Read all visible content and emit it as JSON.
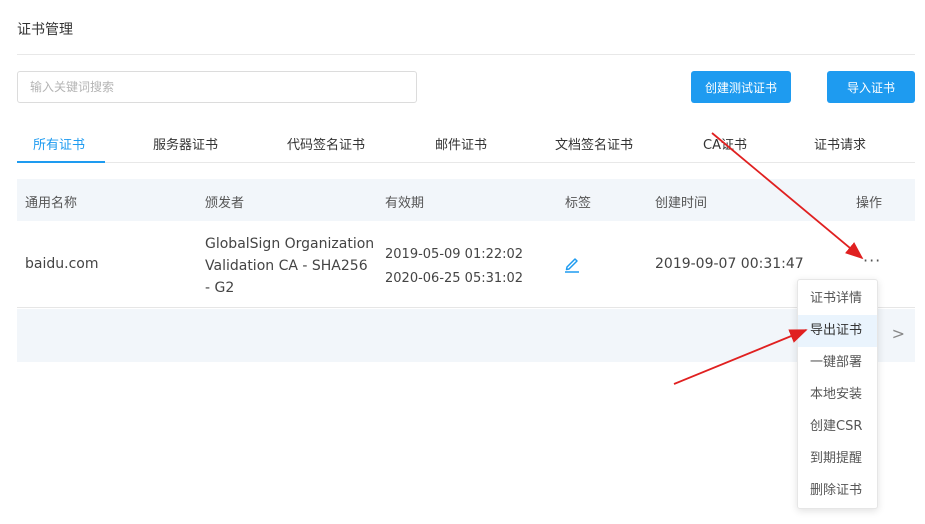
{
  "header": {
    "title": "证书管理"
  },
  "search": {
    "placeholder": "输入关键词搜索",
    "value": ""
  },
  "actions": {
    "create_test_label": "创建测试证书",
    "import_label": "导入证书"
  },
  "tabs": [
    {
      "label": "所有证书",
      "active": true
    },
    {
      "label": "服务器证书"
    },
    {
      "label": "代码签名证书"
    },
    {
      "label": "邮件证书"
    },
    {
      "label": "文档签名证书"
    },
    {
      "label": "CA证书"
    },
    {
      "label": "证书请求"
    }
  ],
  "table": {
    "columns": [
      "通用名称",
      "颁发者",
      "有效期",
      "标签",
      "创建时间",
      "操作"
    ],
    "rows": [
      {
        "common_name": "baidu.com",
        "issuer_lines": [
          "GlobalSign Organization",
          "Validation CA - SHA256",
          "- G2"
        ],
        "valid_from": "2019-05-09 01:22:02",
        "valid_to": "2020-06-25 05:31:02",
        "tag_icon": "pencil-icon",
        "created": "2019-09-07 00:31:47",
        "more_label": "···"
      }
    ]
  },
  "pager": {
    "next_label": ">"
  },
  "context_menu": {
    "items": [
      "证书详情",
      "导出证书",
      "一键部署",
      "本地安装",
      "创建CSR",
      "到期提醒",
      "删除证书"
    ],
    "highlighted_index": 1
  },
  "colors": {
    "accent": "#1e9bf0",
    "annotation_arrow": "#e02020",
    "header_bg": "#f2f6fa"
  }
}
